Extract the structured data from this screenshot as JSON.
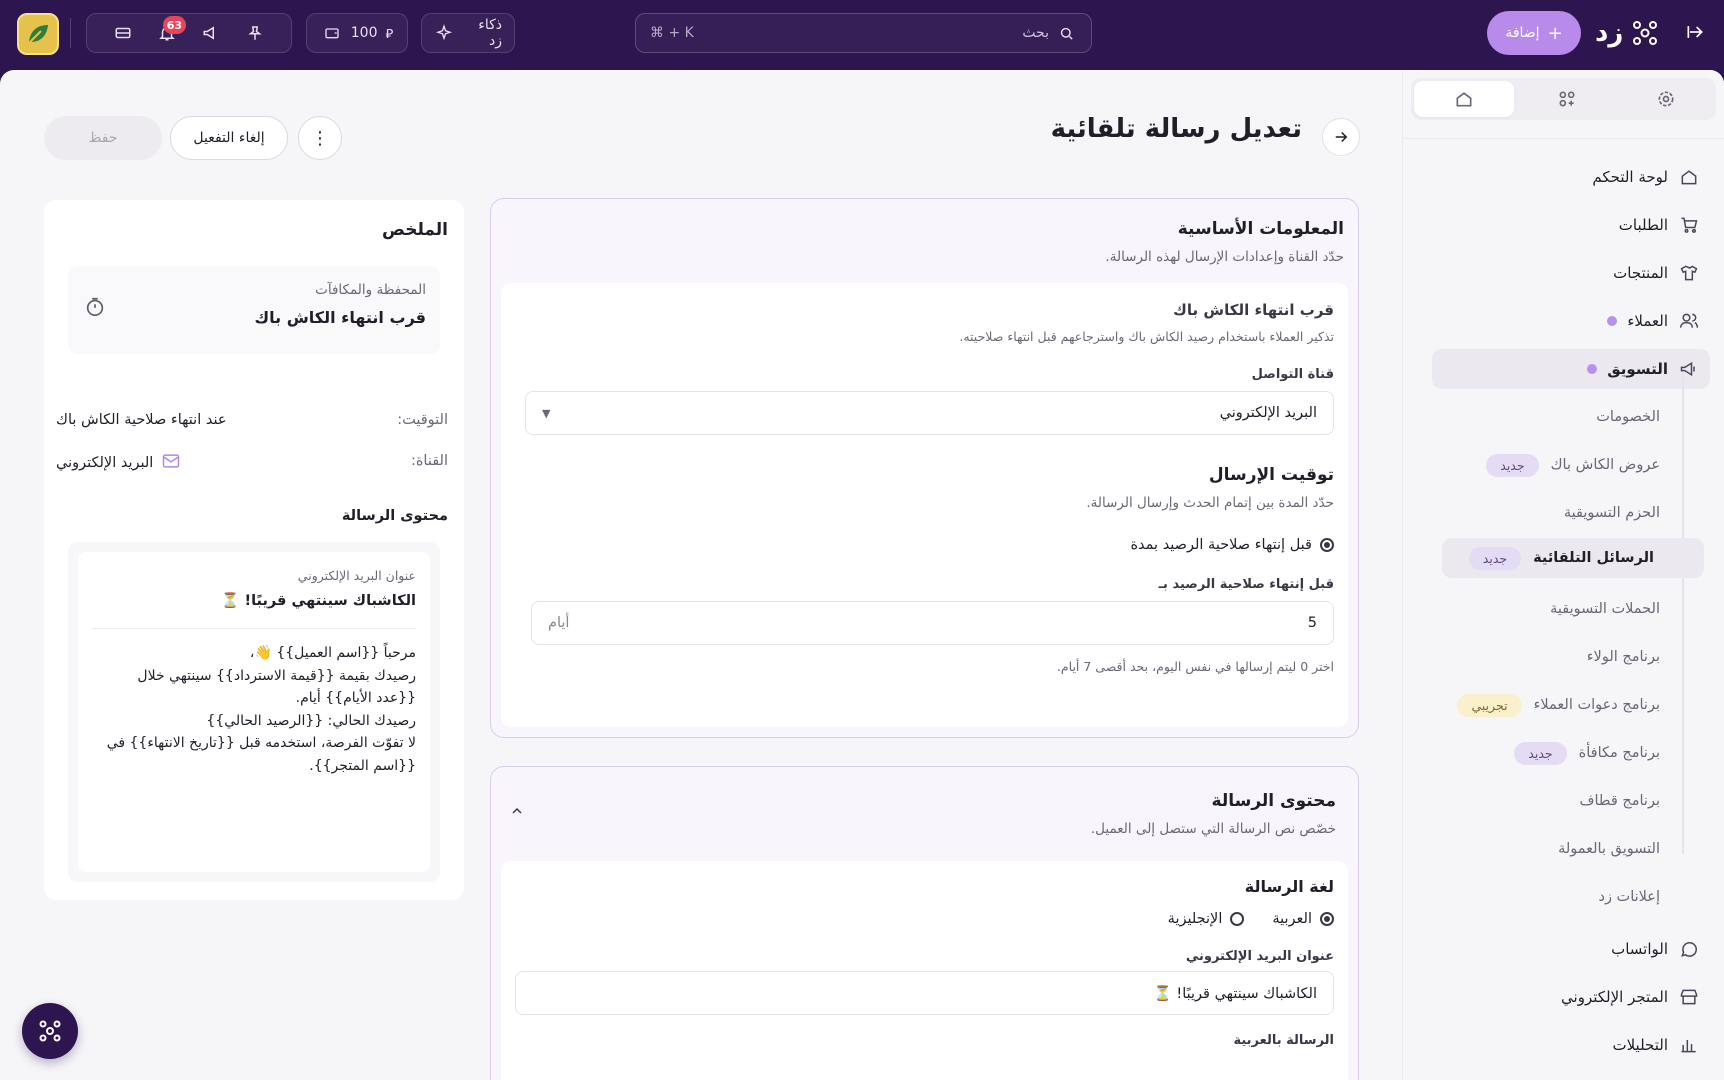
{
  "topbar": {
    "add_label": "إضافة",
    "brand": "زد",
    "search_placeholder": "بحث",
    "search_shortcut": "⌘ + K",
    "ai_label": "ذكاء زد",
    "balance": "100",
    "currency_symbol": "⃁",
    "notifications_count": "63"
  },
  "page": {
    "title": "تعديل رسالة تلقائية",
    "save_label": "حفظ",
    "deactivate_label": "إلغاء التفعيل"
  },
  "sidebar": {
    "main_items": [
      {
        "label": "لوحة التحكم",
        "icon": "home-icon"
      },
      {
        "label": "الطلبات",
        "icon": "cart-icon"
      },
      {
        "label": "المنتجات",
        "icon": "shirt-icon"
      },
      {
        "label": "العملاء",
        "icon": "users-icon"
      },
      {
        "label": "التسويق",
        "icon": "megaphone-icon"
      }
    ],
    "sub_items": [
      {
        "label": "الخصومات",
        "badge": ""
      },
      {
        "label": "عروض الكاش باك",
        "badge": "جديد"
      },
      {
        "label": "الحزم التسويقية",
        "badge": ""
      },
      {
        "label": "الرسائل التلقائية",
        "badge": "جديد"
      },
      {
        "label": "الحملات التسويقية",
        "badge": ""
      },
      {
        "label": "برنامج الولاء",
        "badge": ""
      },
      {
        "label": "برنامج دعوات العملاء",
        "badge": "تجريبي"
      },
      {
        "label": "برنامج مكافأة",
        "badge": "جديد"
      },
      {
        "label": "برنامج قطاف",
        "badge": ""
      },
      {
        "label": "التسويق بالعمولة",
        "badge": ""
      },
      {
        "label": "إعلانات زد",
        "badge": ""
      }
    ],
    "bottom_items": [
      {
        "label": "الواتساب",
        "icon": "whatsapp-icon"
      },
      {
        "label": "المتجر الإلكتروني",
        "icon": "store-icon"
      },
      {
        "label": "التحليلات",
        "icon": "chart-icon"
      }
    ]
  },
  "basic_info": {
    "title": "المعلومات الأساسية",
    "subtitle": "حدّد القناة وإعدادات الإرسال لهذه الرسالة.",
    "event_title": "قرب انتهاء الكاش باك",
    "event_desc": "تذكير العملاء باستخدام رصيد الكاش باك واسترجاعهم قبل انتهاء صلاحيته.",
    "channel_label": "قناة التواصل",
    "channel_value": "البريد الإلكتروني",
    "timing_title": "توقيت الإرسال",
    "timing_desc": "حدّد المدة بين إتمام الحدث وإرسال الرسالة.",
    "timing_option": "قبل إنتهاء صلاحية الرصيد بمدة",
    "timing_field_label": "قبل إنتهاء صلاحية الرصيد بـ",
    "timing_value": "5",
    "timing_unit": "أيام",
    "timing_hint": "اختر 0 ليتم إرسالها في نفس اليوم، بحد أقصى 7 أيام."
  },
  "message_content": {
    "title": "محتوى الرسالة",
    "subtitle": "خصّص نص الرسالة التي ستصل إلى العميل.",
    "language_label": "لغة الرسالة",
    "lang_ar": "العربية",
    "lang_en": "الإنجليزية",
    "email_subject_label": "عنوان البريد الإلكتروني",
    "email_subject_value": "الكاشباك سينتهي قريبًا! ⏳",
    "arabic_message_label": "الرسالة بالعربية"
  },
  "summary": {
    "title": "الملخص",
    "category": "المحفظة والمكافآت",
    "event": "قرب انتهاء الكاش باك",
    "timing_label": "التوقيت:",
    "timing_value": "عند انتهاء صلاحية الكاش باك",
    "channel_label": "القناة:",
    "channel_value": "البريد الإلكتروني",
    "content_label": "محتوى الرسالة",
    "preview_subject_label": "عنوان البريد الإلكتروني",
    "preview_subject": "الكاشباك سينتهي قريبًا! ⏳",
    "preview_lines": [
      "مرحباً {{اسم العميل}} 👋،",
      "رصيدك بقيمة {{قيمة الاسترداد}} سينتهي خلال",
      "{{عدد الأيام}} أيام.",
      "رصيدك الحالي: {{الرصيد الحالي}}",
      "لا تفوّت الفرصة، استخدمه قبل {{تاريخ الانتهاء}} في",
      "{{اسم المتجر}}."
    ]
  },
  "colors": {
    "topbar": "#2d1650",
    "accent": "#b88ae9",
    "notification_badge": "#e8455a"
  }
}
